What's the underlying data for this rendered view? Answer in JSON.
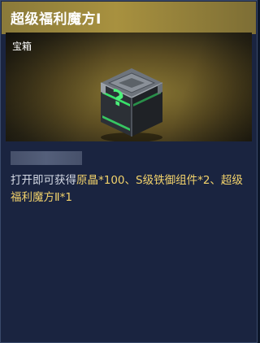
{
  "item": {
    "name": "超级福利魔方Ⅰ",
    "type": "宝箱"
  },
  "description": {
    "prefix": "打开即可获得",
    "rewards": "原晶*100、S级铁御组件*2、超级福利魔方Ⅱ*1"
  },
  "icons": {
    "item_icon": "mystery-box-icon"
  },
  "colors": {
    "header_gold": "#a8913f",
    "reward_text": "#f2d26b",
    "box_accent": "#39e06a"
  }
}
